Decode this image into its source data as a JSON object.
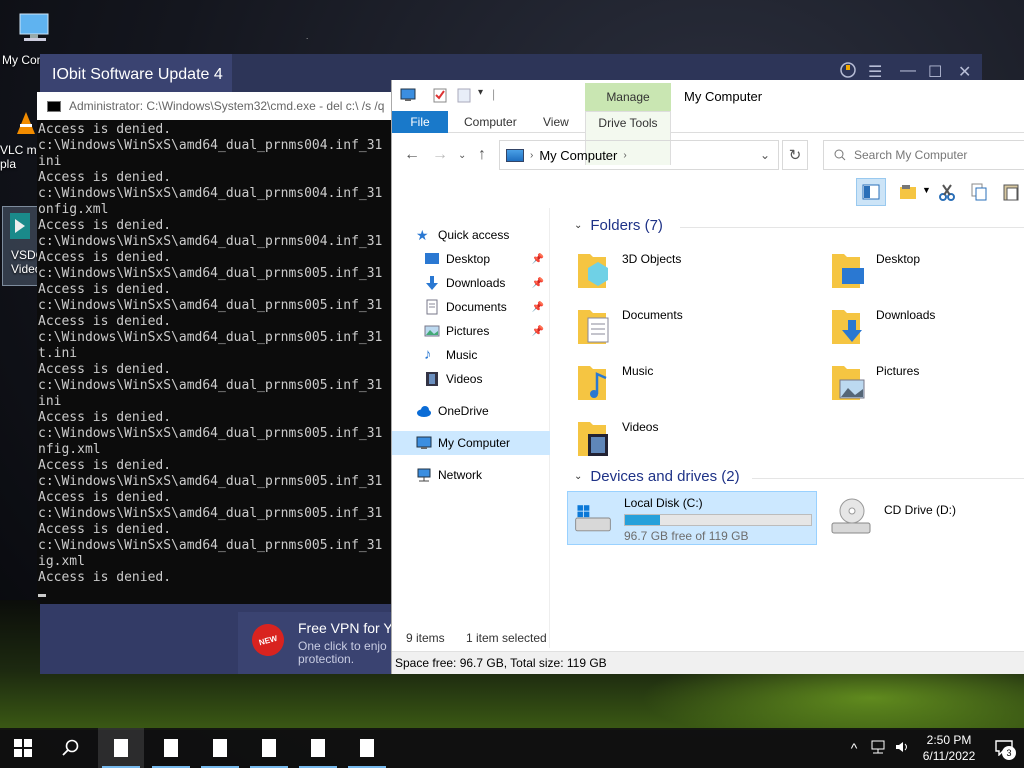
{
  "desktop": {
    "icons": [
      {
        "label": "My Com"
      },
      {
        "label": "VLC m\npla"
      },
      {
        "label": "VSDC\nVideo"
      }
    ]
  },
  "iobit": {
    "title": "IObit Software Update 4",
    "vpn_badge": "NEW",
    "vpn_title": "Free VPN for Yo",
    "vpn_sub": "One click to enjo\nprotection."
  },
  "cmd": {
    "title": "Administrator: C:\\Windows\\System32\\cmd.exe - del  c:\\ /s /q",
    "lines": [
      "Access is denied.",
      "c:\\Windows\\WinSxS\\amd64_dual_prnms004.inf_31",
      "ini",
      "Access is denied.",
      "c:\\Windows\\WinSxS\\amd64_dual_prnms004.inf_31",
      "onfig.xml",
      "Access is denied.",
      "c:\\Windows\\WinSxS\\amd64_dual_prnms004.inf_31",
      "Access is denied.",
      "c:\\Windows\\WinSxS\\amd64_dual_prnms005.inf_31",
      "Access is denied.",
      "c:\\Windows\\WinSxS\\amd64_dual_prnms005.inf_31",
      "Access is denied.",
      "c:\\Windows\\WinSxS\\amd64_dual_prnms005.inf_31",
      "t.ini",
      "Access is denied.",
      "c:\\Windows\\WinSxS\\amd64_dual_prnms005.inf_31",
      "ini",
      "Access is denied.",
      "c:\\Windows\\WinSxS\\amd64_dual_prnms005.inf_31",
      "nfig.xml",
      "Access is denied.",
      "c:\\Windows\\WinSxS\\amd64_dual_prnms005.inf_31",
      "Access is denied.",
      "c:\\Windows\\WinSxS\\amd64_dual_prnms005.inf_31",
      "Access is denied.",
      "c:\\Windows\\WinSxS\\amd64_dual_prnms005.inf_31",
      "ig.xml",
      "Access is denied."
    ]
  },
  "explorer": {
    "manage_label": "Manage",
    "title": "My Computer",
    "tabs": {
      "file": "File",
      "computer": "Computer",
      "view": "View",
      "drive_tools": "Drive Tools"
    },
    "address": "My Computer",
    "search_placeholder": "Search My Computer",
    "nav": {
      "quick_access": "Quick access",
      "desktop": "Desktop",
      "downloads": "Downloads",
      "documents": "Documents",
      "pictures": "Pictures",
      "music": "Music",
      "videos": "Videos",
      "onedrive": "OneDrive",
      "my_computer": "My Computer",
      "network": "Network"
    },
    "folders_header": "Folders (7)",
    "folders": [
      "3D Objects",
      "Desktop",
      "Documents",
      "Downloads",
      "Music",
      "Pictures",
      "Videos"
    ],
    "drives_header": "Devices and drives (2)",
    "drives": [
      {
        "name": "Local Disk (C:)",
        "free": "96.7 GB free of 119 GB",
        "used_fraction": 0.19
      },
      {
        "name": "CD Drive (D:)"
      }
    ],
    "status_items": "9 items",
    "status_selected": "1 item selected",
    "bottom_info": "Space free: 96.7 GB, Total size: 119 GB"
  },
  "taskbar": {
    "time": "2:50 PM",
    "date": "6/11/2022",
    "notification_count": "3"
  }
}
